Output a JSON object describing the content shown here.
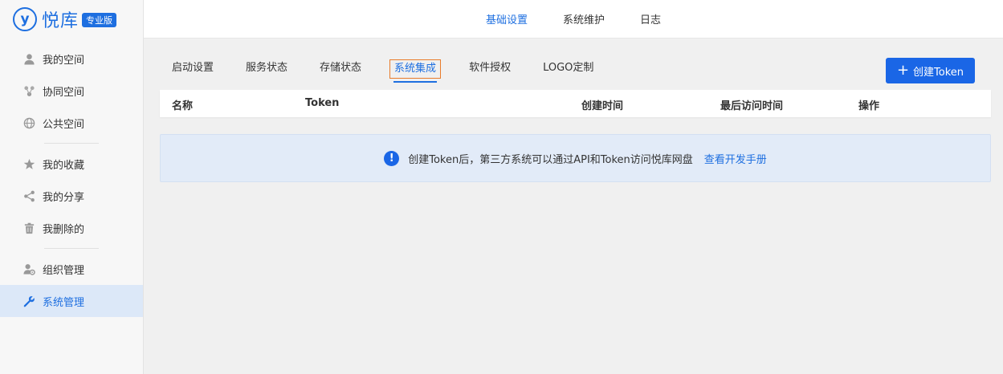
{
  "brand": {
    "mark": "y",
    "name": "悦库",
    "badge": "专业版"
  },
  "sidebar": {
    "items": [
      {
        "label": "我的空间"
      },
      {
        "label": "协同空间"
      },
      {
        "label": "公共空间"
      },
      {
        "label": "我的收藏"
      },
      {
        "label": "我的分享"
      },
      {
        "label": "我删除的"
      },
      {
        "label": "组织管理"
      },
      {
        "label": "系统管理"
      }
    ]
  },
  "topnav": {
    "items": [
      "基础设置",
      "系统维护",
      "日志"
    ]
  },
  "subtabs": {
    "items": [
      "启动设置",
      "服务状态",
      "存储状态",
      "系统集成",
      "软件授权",
      "LOGO定制"
    ]
  },
  "actions": {
    "create_token": "创建Token"
  },
  "table": {
    "columns": [
      "名称",
      "Token",
      "创建时间",
      "最后访问时间",
      "操作"
    ]
  },
  "notice": {
    "icon": "!",
    "text": "创建Token后，第三方系统可以通过API和Token访问悦库网盘",
    "link": "查看开发手册"
  },
  "colors": {
    "accent": "#1e6fe0",
    "button": "#1a66e6",
    "highlight_border": "#e87c2b"
  }
}
